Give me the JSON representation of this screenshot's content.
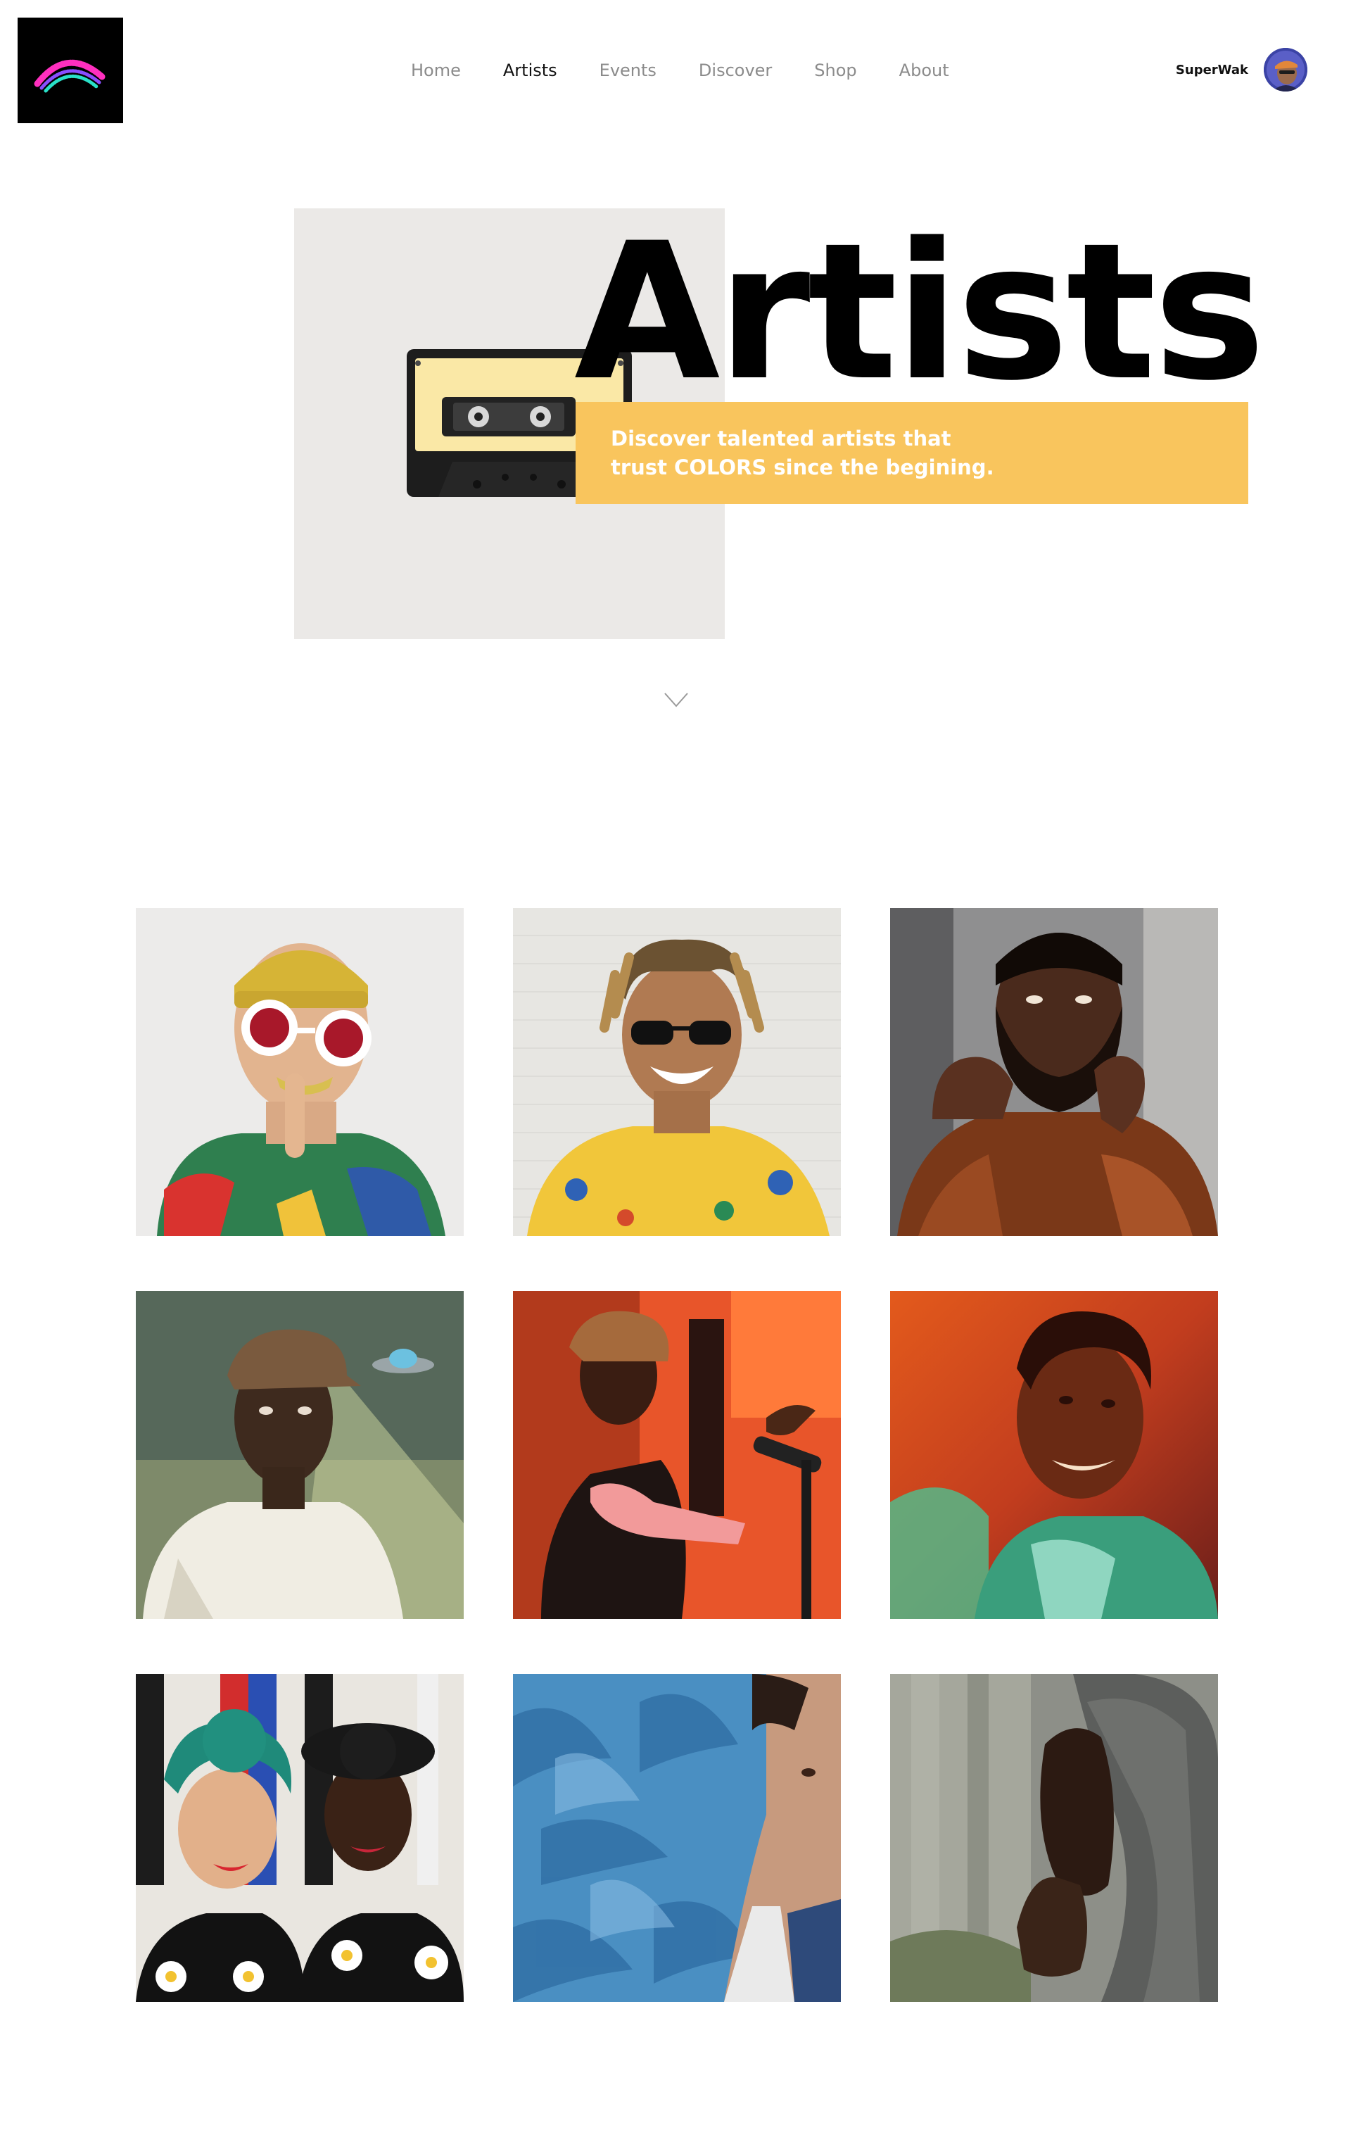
{
  "header": {
    "logo_icon": "rainbow-arc-logo",
    "nav": [
      {
        "label": "Home",
        "active": false
      },
      {
        "label": "Artists",
        "active": true
      },
      {
        "label": "Events",
        "active": false
      },
      {
        "label": "Discover",
        "active": false
      },
      {
        "label": "Shop",
        "active": false
      },
      {
        "label": "About",
        "active": false
      }
    ],
    "user": {
      "name": "SuperWak",
      "avatar_icon": "user-avatar"
    }
  },
  "hero": {
    "title": "Artists",
    "tagline_line1": "Discover talented artists that",
    "tagline_line2": "trust COLORS since the begining.",
    "image_icon": "cassette-tape-photo",
    "scroll_icon": "chevron-down-icon",
    "banner_color": "#f9c55d"
  },
  "artists": [
    {
      "image_icon": "artist-portrait-yellow-beanie"
    },
    {
      "image_icon": "artist-portrait-sunglasses-yellow-shirt"
    },
    {
      "image_icon": "artist-portrait-beard-leather-jacket"
    },
    {
      "image_icon": "artist-portrait-flat-cap-ufo"
    },
    {
      "image_icon": "artist-portrait-red-studio"
    },
    {
      "image_icon": "artist-portrait-neon-glow"
    },
    {
      "image_icon": "artist-portrait-duo-headwraps"
    },
    {
      "image_icon": "artist-portrait-blue-leaves"
    },
    {
      "image_icon": "artist-portrait-grey-hoodie"
    }
  ]
}
